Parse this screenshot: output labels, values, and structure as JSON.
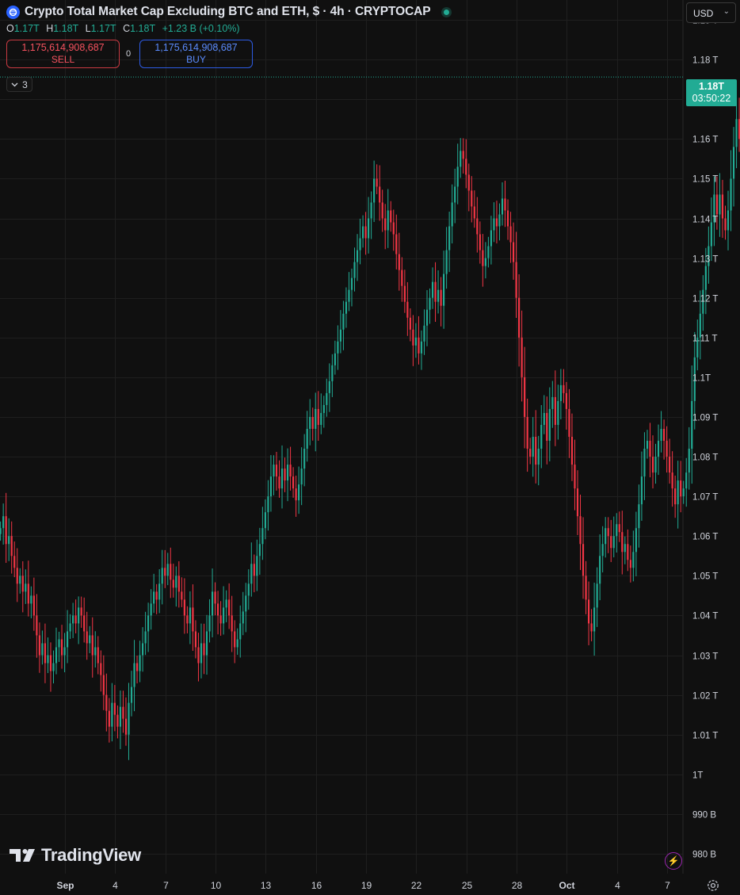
{
  "header": {
    "title": "Crypto Total Market Cap Excluding BTC and ETH, $ · 4h · CRYPTOCAP",
    "icon": "crypto-cap-icon",
    "status": "live-dot"
  },
  "ohlc": {
    "o_label": "O",
    "o": "1.17T",
    "h_label": "H",
    "h": "1.18T",
    "l_label": "L",
    "l": "1.17T",
    "c_label": "C",
    "c": "1.18T",
    "change": "+1.23 B (+0.10%)"
  },
  "trade": {
    "sell_price": "1,175,614,908,687",
    "sell_label": "SELL",
    "spread": "0",
    "buy_price": "1,175,614,908,687",
    "buy_label": "BUY"
  },
  "indicators_toggle": {
    "count": "3"
  },
  "currency_select": {
    "value": "USD"
  },
  "last_price_tag": {
    "price": "1.18T",
    "countdown": "03:50:22"
  },
  "branding": {
    "logo_text": "TradingView"
  },
  "colors": {
    "background": "#101010",
    "grid": "#1f1f1f",
    "up": "#22ab94",
    "down": "#f23645",
    "axis_text": "#d1d4dc"
  },
  "chart_data": {
    "type": "candlestick",
    "timeframe": "4h",
    "y_axis": {
      "unit": "USD",
      "ylim": [
        975000000000,
        1195000000000
      ],
      "tick_values": [
        980000000000,
        990000000000,
        1000000000000,
        1010000000000,
        1020000000000,
        1030000000000,
        1040000000000,
        1050000000000,
        1060000000000,
        1070000000000,
        1080000000000,
        1090000000000,
        1100000000000,
        1110000000000,
        1120000000000,
        1130000000000,
        1140000000000,
        1150000000000,
        1160000000000,
        1170000000000,
        1180000000000,
        1190000000000
      ],
      "tick_labels": [
        "980 B",
        "990 B",
        "1T",
        "1.01 T",
        "1.02 T",
        "1.03 T",
        "1.04 T",
        "1.05 T",
        "1.06 T",
        "1.07 T",
        "1.08 T",
        "1.09 T",
        "1.1T",
        "1.11 T",
        "1.12 T",
        "1.13 T",
        "1.14 T",
        "1.15 T",
        "1.16 T",
        "1.17 T",
        "1.18 T",
        "1.19 T"
      ]
    },
    "x_axis": {
      "tick_labels": [
        "Sep",
        "4",
        "7",
        "10",
        "13",
        "16",
        "19",
        "22",
        "25",
        "28",
        "Oct",
        "4",
        "7"
      ],
      "tick_days": [
        3,
        6,
        9,
        12,
        15,
        18,
        21,
        24,
        27,
        30,
        33,
        36,
        39
      ],
      "xlim_days": [
        -0.88,
        39.95
      ]
    },
    "last_price": 1175614908687,
    "grid": true,
    "series": [
      {
        "name": "Crypto Total Market Cap Excluding BTC and ETH",
        "candle_start_day": -0.85,
        "candles_per_day": 6,
        "closes_billion": [
          1062,
          1065,
          1058,
          1060,
          1055,
          1052,
          1048,
          1050,
          1046,
          1048,
          1043,
          1045,
          1040,
          1035,
          1030,
          1033,
          1028,
          1030,
          1026,
          1028,
          1032,
          1034,
          1030,
          1032,
          1036,
          1038,
          1040,
          1038,
          1042,
          1040,
          1036,
          1033,
          1035,
          1030,
          1032,
          1028,
          1025,
          1020,
          1016,
          1012,
          1018,
          1015,
          1012,
          1017,
          1014,
          1010,
          1018,
          1022,
          1028,
          1026,
          1030,
          1033,
          1036,
          1040,
          1043,
          1046,
          1044,
          1048,
          1052,
          1050,
          1053,
          1049,
          1047,
          1050,
          1046,
          1044,
          1040,
          1038,
          1042,
          1036,
          1032,
          1028,
          1033,
          1030,
          1036,
          1040,
          1046,
          1043,
          1040,
          1038,
          1042,
          1044,
          1040,
          1036,
          1032,
          1034,
          1038,
          1041,
          1045,
          1048,
          1053,
          1050,
          1055,
          1058,
          1062,
          1066,
          1070,
          1075,
          1078,
          1075,
          1072,
          1077,
          1074,
          1078,
          1075,
          1072,
          1069,
          1073,
          1077,
          1082,
          1087,
          1090,
          1087,
          1092,
          1088,
          1091,
          1093,
          1096,
          1099,
          1103,
          1106,
          1109,
          1112,
          1116,
          1119,
          1122,
          1125,
          1129,
          1132,
          1135,
          1138,
          1135,
          1140,
          1144,
          1150,
          1148,
          1144,
          1140,
          1137,
          1142,
          1139,
          1136,
          1131,
          1127,
          1123,
          1119,
          1115,
          1112,
          1108,
          1110,
          1106,
          1109,
          1113,
          1117,
          1120,
          1124,
          1119,
          1122,
          1118,
          1126,
          1132,
          1138,
          1144,
          1148,
          1153,
          1157,
          1155,
          1151,
          1147,
          1143,
          1140,
          1136,
          1132,
          1128,
          1130,
          1133,
          1137,
          1140,
          1138,
          1141,
          1145,
          1142,
          1138,
          1134,
          1129,
          1120,
          1110,
          1100,
          1090,
          1082,
          1080,
          1085,
          1078,
          1082,
          1088,
          1091,
          1084,
          1092,
          1095,
          1088,
          1094,
          1098,
          1096,
          1092,
          1085,
          1078,
          1072,
          1065,
          1058,
          1050,
          1044,
          1038,
          1036,
          1042,
          1048,
          1055,
          1058,
          1062,
          1060,
          1057,
          1060,
          1063,
          1061,
          1056,
          1058,
          1054,
          1052,
          1056,
          1062,
          1068,
          1075,
          1082,
          1084,
          1080,
          1076,
          1080,
          1084,
          1087,
          1084,
          1080,
          1076,
          1072,
          1068,
          1074,
          1070,
          1072,
          1076,
          1082,
          1094,
          1105,
          1110,
          1116,
          1122,
          1128,
          1133,
          1139,
          1146,
          1141,
          1146,
          1140,
          1137,
          1142,
          1150,
          1158,
          1165,
          1160,
          1154,
          1150,
          1147,
          1142,
          1140,
          1137,
          1132,
          1145,
          1155,
          1168,
          1160,
          1152,
          1145,
          1138,
          1140,
          1145,
          1150,
          1160,
          1166,
          1171,
          1174,
          1176
        ]
      }
    ]
  }
}
